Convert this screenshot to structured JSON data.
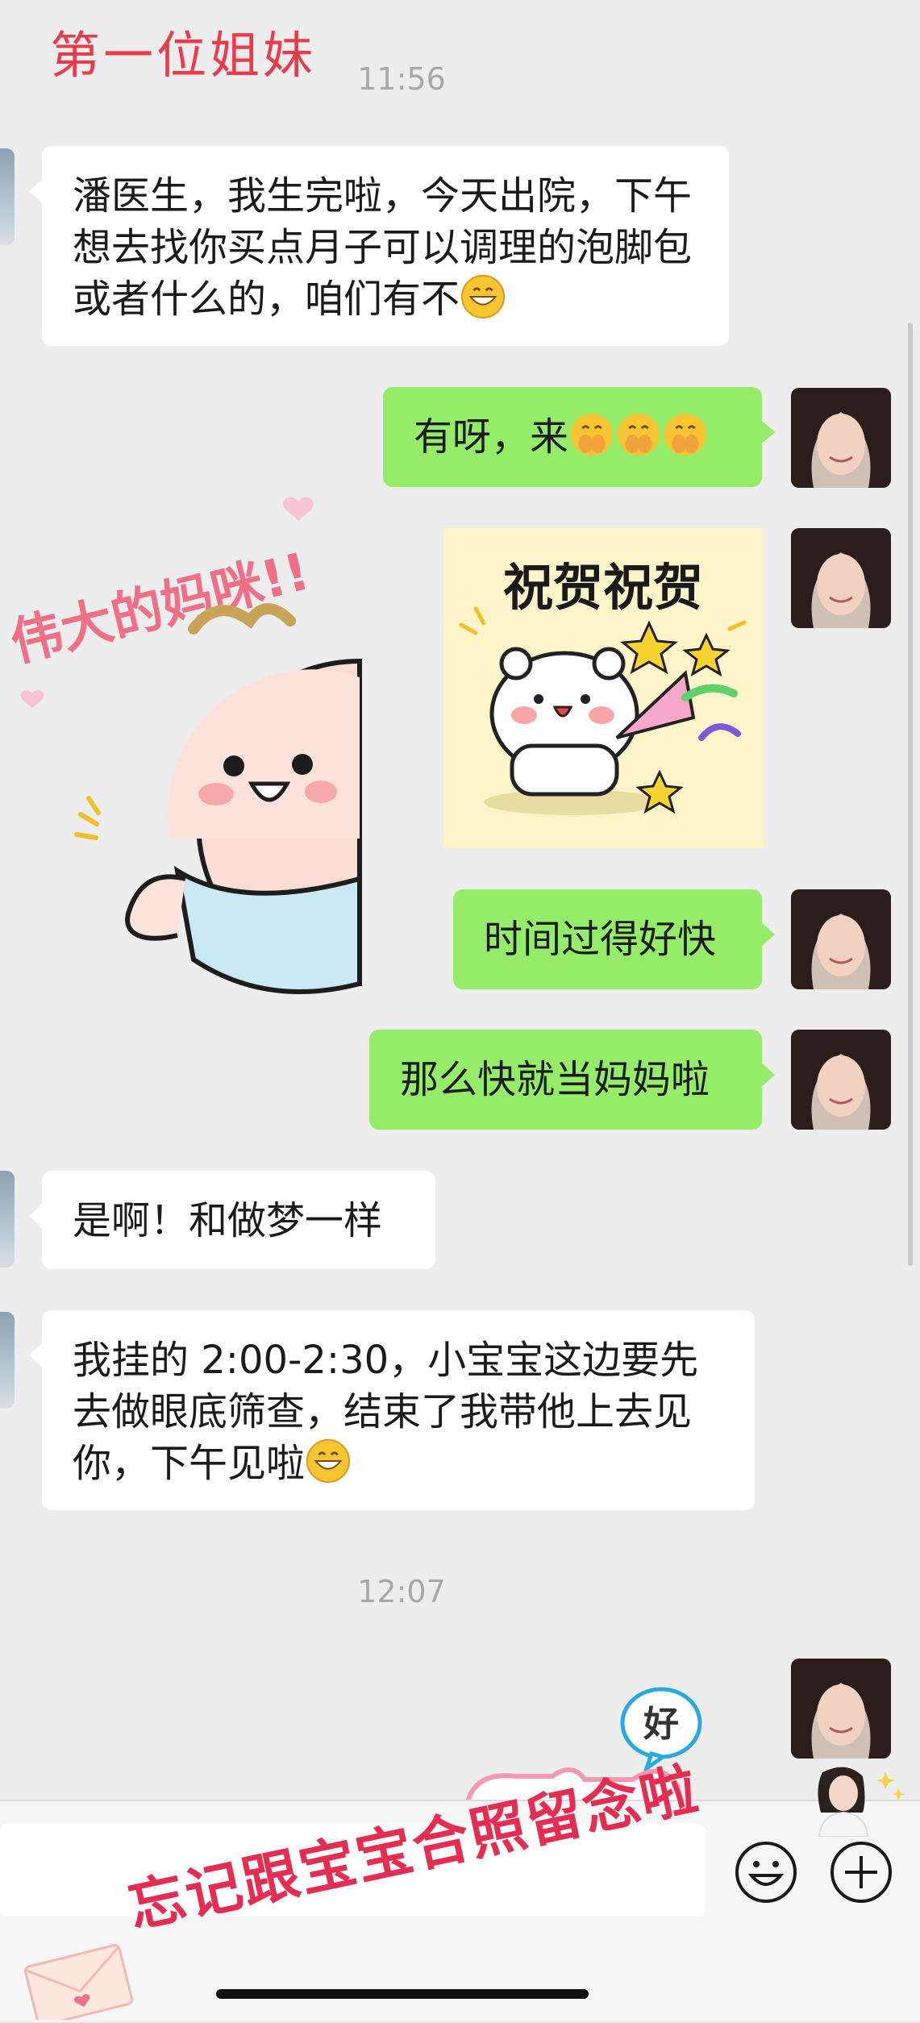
{
  "overlay_title": "第一位姐妹",
  "times": [
    "11:56",
    "12:07"
  ],
  "messages": {
    "m1": {
      "text": "潘医生，我生完啦，今天出院，下午想去找你买点月子可以调理的泡脚包或者什么的，咱们有不"
    },
    "m2": {
      "text": "有呀，来"
    },
    "m3": {
      "sticker_text": "祝贺祝贺"
    },
    "m4": {
      "sticker_text": "伟大的妈咪!!"
    },
    "m5": {
      "text": "时间过得好快"
    },
    "m6": {
      "text": "那么快就当妈妈啦"
    },
    "m7": {
      "text": "是啊！和做梦一样"
    },
    "m8": {
      "text": "我挂的 2:00-2:30，小宝宝这边要先去做眼底筛查，结束了我带他上去见你，下午见啦"
    },
    "m9": {
      "sticker_text": "好"
    }
  },
  "overlay_stamp": "忘记跟宝宝合照留念啦",
  "icons": {
    "emoji_button": "smiley-face-icon",
    "plus_button": "plus-circle-icon"
  },
  "colors": {
    "sent_bubble": "#95ec69",
    "received_bubble": "#ffffff",
    "background": "#ededed",
    "overlay_red": "#ec3a4a"
  }
}
